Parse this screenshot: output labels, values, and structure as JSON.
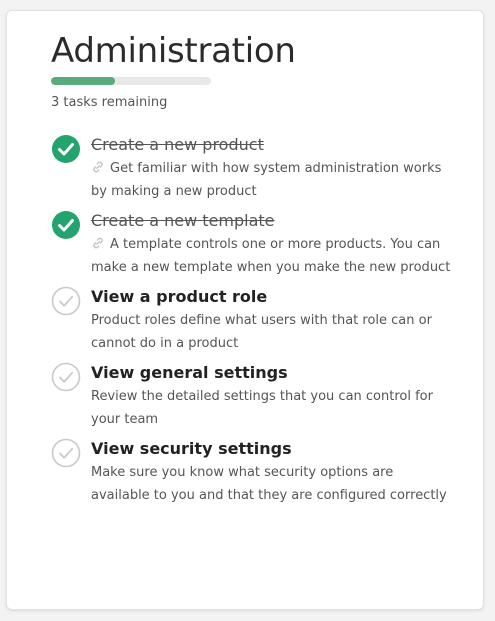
{
  "header": {
    "title": "Administration",
    "progress_fraction": 0.4,
    "remaining_text": "3 tasks remaining"
  },
  "colors": {
    "accent": "#5aab7c",
    "done_icon": "#23a36d",
    "pending_icon": "#c9c9c9"
  },
  "tasks": [
    {
      "title": "Create a new product",
      "description": "Get familiar with how system administration works by making a new product",
      "status": "complete",
      "icon": "check-circle-filled-icon",
      "desc_icon": "link-icon"
    },
    {
      "title": "Create a new template",
      "description": "A template controls one or more products. You can make a new template when you make the new product",
      "status": "complete",
      "icon": "check-circle-filled-icon",
      "desc_icon": "link-icon"
    },
    {
      "title": "View a product role",
      "description": "Product roles define what users with that role can or cannot do in a product",
      "status": "pending",
      "icon": "check-circle-outline-icon"
    },
    {
      "title": "View general settings",
      "description": "Review the detailed settings that you can control for your team",
      "status": "pending",
      "icon": "check-circle-outline-icon"
    },
    {
      "title": "View security settings",
      "description": "Make sure you know what security options are available to you and that they are configured correctly",
      "status": "pending",
      "icon": "check-circle-outline-icon"
    }
  ]
}
